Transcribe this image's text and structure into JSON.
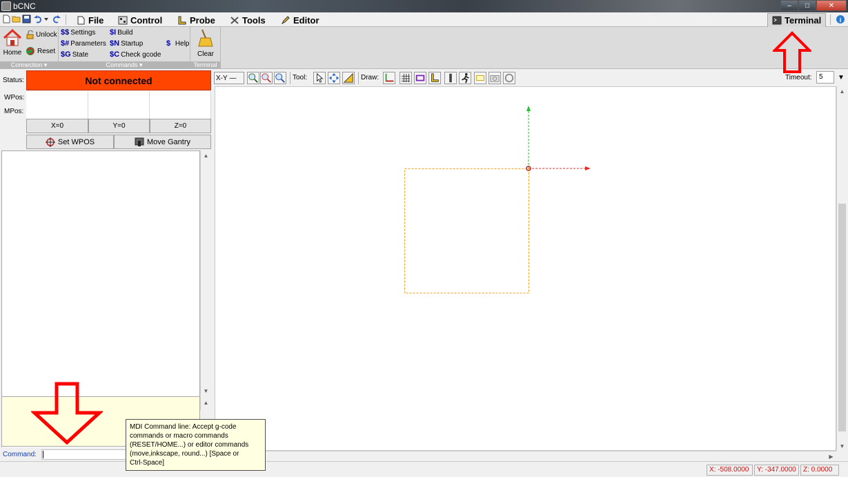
{
  "window": {
    "title": "bCNC"
  },
  "menu": {
    "tabs": [
      {
        "label": "File"
      },
      {
        "label": "Control"
      },
      {
        "label": "Probe"
      },
      {
        "label": "Tools"
      },
      {
        "label": "Editor"
      }
    ],
    "terminal_tab": "Terminal"
  },
  "ribbon": {
    "connection": {
      "home": "Home",
      "unlock": "Unlock",
      "reset": "Reset",
      "group_label": "Connection"
    },
    "commands": {
      "settings": "Settings",
      "settings_code": "$$",
      "parameters": "Parameters",
      "parameters_code": "$#",
      "state": "State",
      "state_code": "$G",
      "build": "Build",
      "build_code": "$I",
      "startup": "Startup",
      "startup_code": "$N",
      "check": "Check gcode",
      "check_code": "$C",
      "help": "Help",
      "help_code": "$",
      "group_label": "Commands"
    },
    "terminal": {
      "clear": "Clear",
      "group_label": "Terminal"
    }
  },
  "left": {
    "status_label": "Status:",
    "status_value": "Not connected",
    "wpos_label": "WPos:",
    "mpos_label": "MPos:",
    "zero_x": "X=0",
    "zero_y": "Y=0",
    "zero_z": "Z=0",
    "set_wpos": "Set WPOS",
    "move_gantry": "Move Gantry"
  },
  "canvas_toolbar": {
    "view": "X-Y",
    "tool_label": "Tool:",
    "draw_label": "Draw:",
    "timeout_label": "Timeout:",
    "timeout_value": "5"
  },
  "command": {
    "label": "Command:",
    "value": ""
  },
  "tooltip": {
    "lines": [
      "MDI Command line: Accept g-code",
      "commands or macro commands",
      "(RESET/HOME...) or editor commands",
      "(move,inkscape, round...) [Space or",
      "Ctrl-Space]"
    ]
  },
  "statusbar": {
    "x": "X: -508.0000",
    "y": "Y: -347.0000",
    "z": "Z: 0.0000"
  },
  "colors": {
    "status_bg": "#ff4500",
    "annotation_arrow": "#ff0000",
    "x_axis": "#e03030",
    "y_axis": "#20c030",
    "work_area": "#f0a020"
  }
}
